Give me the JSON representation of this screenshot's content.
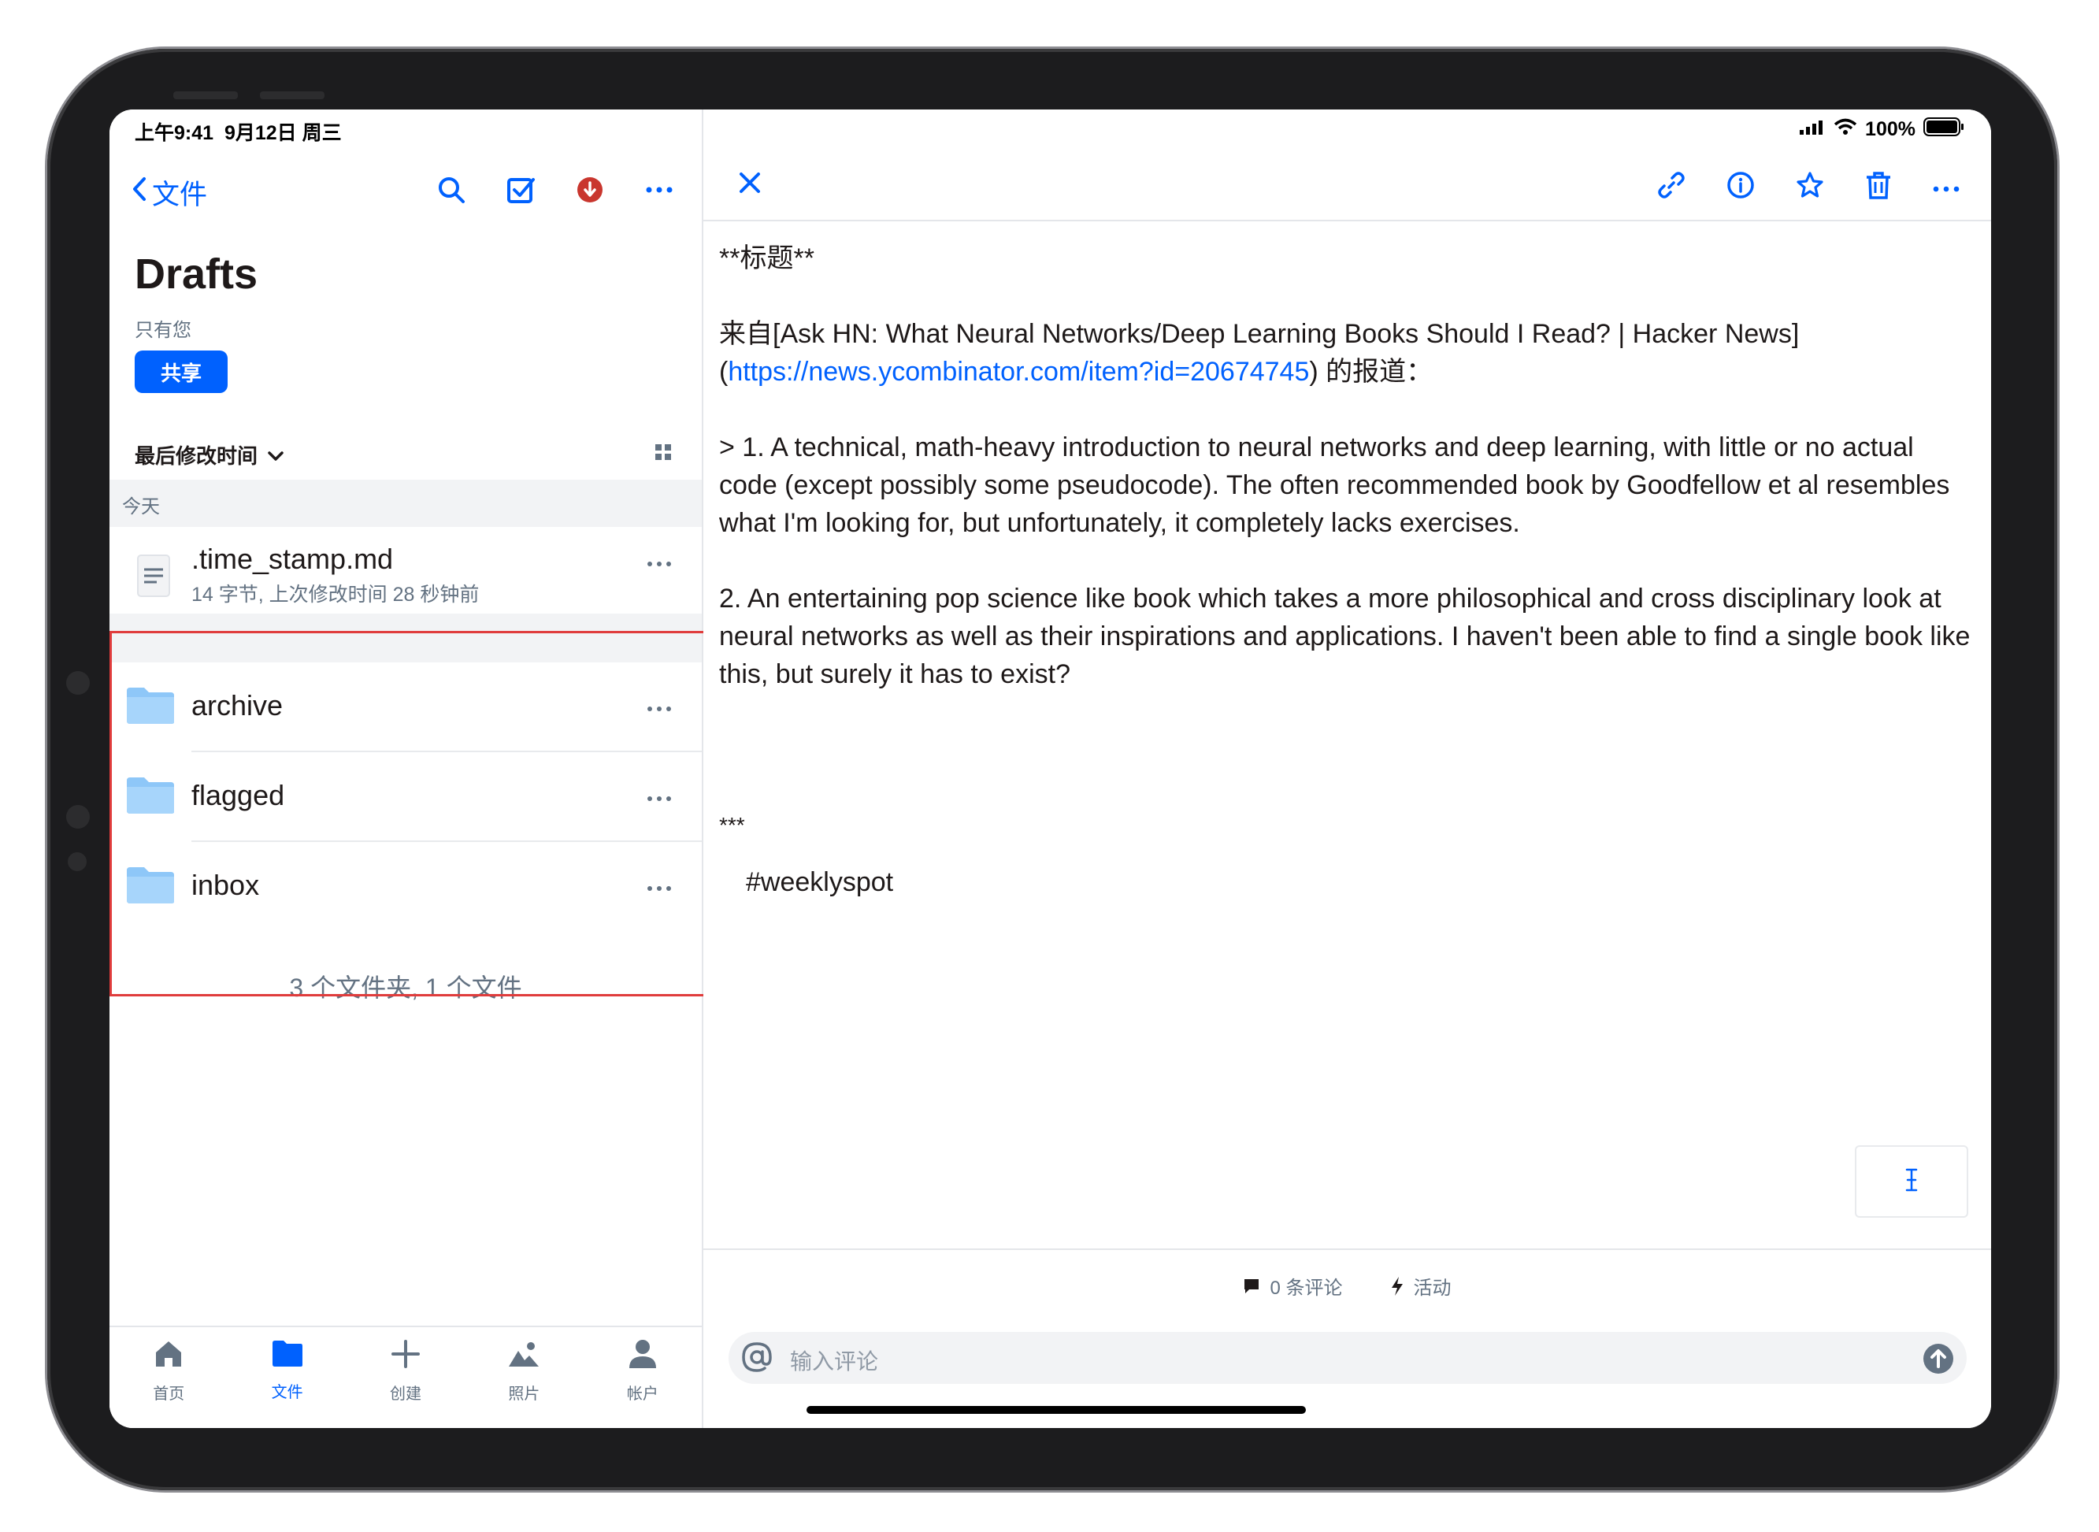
{
  "status": {
    "time": "上午9:41",
    "date": "9月12日 周三",
    "battery": "100%"
  },
  "left": {
    "back_label": "文件",
    "title": "Drafts",
    "subtitle": "只有您",
    "share_label": "共享",
    "sort_label": "最后修改时间",
    "section_today": "今天",
    "file": {
      "name": ".time_stamp.md",
      "meta": "14 字节, 上次修改时间 28 秒钟前"
    },
    "folders": [
      {
        "name": "archive"
      },
      {
        "name": "flagged"
      },
      {
        "name": "inbox"
      }
    ],
    "summary": "3 个文件夹, 1 个文件"
  },
  "tabs": [
    {
      "label": "首页",
      "icon": "home-icon"
    },
    {
      "label": "文件",
      "icon": "folder-icon"
    },
    {
      "label": "创建",
      "icon": "plus-icon"
    },
    {
      "label": "照片",
      "icon": "photos-icon"
    },
    {
      "label": "帐户",
      "icon": "person-icon"
    }
  ],
  "doc": {
    "heading": "**标题**",
    "source_prefix": "来自[Ask HN: What Neural Networks/Deep Learning Books Should I Read? | Hacker News](",
    "source_link": "https://news.ycombinator.com/item?id=20674745",
    "source_suffix": ") 的报道：",
    "para1": "> 1. A technical, math-heavy introduction to neural networks and deep learning, with little or no actual code (except possibly some pseudocode). The often recommended book by Goodfellow et al resembles what I'm looking for, but unfortunately, it completely lacks exercises.",
    "para2": "2. An entertaining pop science like book which takes a more philosophical and cross disciplinary look at neural networks as well as their inspirations and applications. I haven't been able to find a single book like this, but surely it has to exist?",
    "hr": "***",
    "tag": "#weeklyspot"
  },
  "comments": {
    "count_label": "0 条评论",
    "activity_label": "活动",
    "placeholder": "输入评论"
  },
  "colors": {
    "accent": "#0061fe",
    "highlight": "#e03c3c",
    "folder": "#8ec7f8"
  }
}
